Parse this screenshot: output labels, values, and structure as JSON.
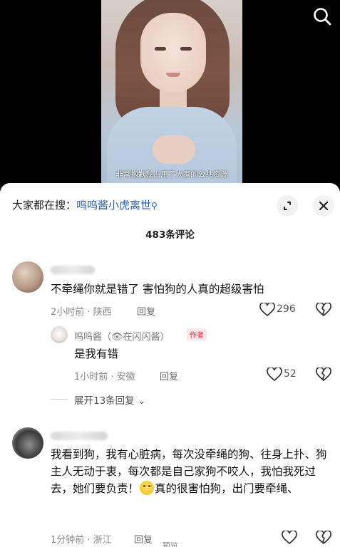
{
  "video": {
    "subtitle": "非常抱歉我占用了大家的公共资源"
  },
  "sheet": {
    "hot_search_prefix": "大家都在搜：",
    "hot_search_keyword": "呜呜酱小虎离世",
    "comment_count": "483条评论"
  },
  "comments": [
    {
      "text": "不牵绳你就是错了 害怕狗的人真的超级害怕",
      "time_location": "2小时前 · 陕西",
      "reply_label": "回复",
      "likes": "296"
    },
    {
      "author": "呜呜酱（👁在闪闪酱）",
      "author_tag": "作者",
      "text": "是我有错",
      "time_location": "1小时前 · 安徽",
      "reply_label": "回复",
      "likes": "52"
    },
    {
      "expand_label": "展开13条回复 ⌄"
    },
    {
      "text_part1": "我看到狗，我有心脏病，每次没牵绳的狗、往身上扑、狗主人无动于衷，每次都是自己家狗不咬人，我怕我死过去，她们要负责！",
      "text_part2": "真的很害怕狗，出门要牵绳、",
      "time_location": "1分钟前 · 浙江",
      "reply_label": "回复",
      "preview_label": "预览"
    }
  ]
}
